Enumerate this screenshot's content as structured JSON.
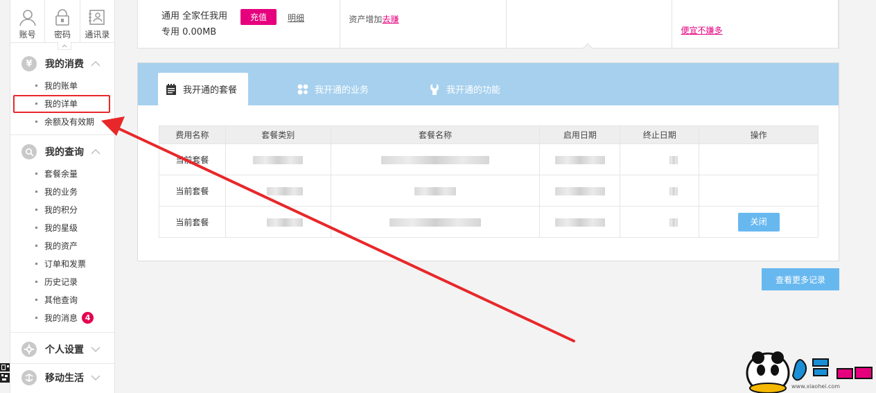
{
  "sidebar": {
    "top_icons": [
      {
        "label": "账号",
        "icon": "user-icon"
      },
      {
        "label": "密码",
        "icon": "lock-icon"
      },
      {
        "label": "通讯录",
        "icon": "contacts-icon"
      }
    ],
    "consumption": {
      "title": "我的消费",
      "icon_glyph": "¥",
      "items": [
        "我的账单",
        "我的详单",
        "余额及有效期"
      ]
    },
    "query": {
      "title": "我的查询",
      "items": [
        "套餐余量",
        "我的业务",
        "我的积分",
        "我的星级",
        "我的资产",
        "订单和发票",
        "历史记录",
        "其他查询",
        "我的消息"
      ],
      "message_badge": "4"
    },
    "settings": {
      "title": "个人设置"
    },
    "mobile_life": {
      "title": "移动生活"
    }
  },
  "summary": {
    "general_data": "通用 全家任我用",
    "special_data": "专用 0.00MB",
    "recharge_label": "充值",
    "detail_link": "明细",
    "asset_text": "资产增加",
    "asset_link": "去赚",
    "deal_link": "便宜不嫌多"
  },
  "panel": {
    "tabs": [
      "我开通的套餐",
      "我开通的业务",
      "我开通的功能"
    ],
    "table": {
      "headers": [
        "费用名称",
        "套餐类别",
        "套餐名称",
        "启用日期",
        "终止日期",
        "操作"
      ],
      "rows": [
        {
          "fee_name": "当前套餐",
          "action": ""
        },
        {
          "fee_name": "当前套餐",
          "action": ""
        },
        {
          "fee_name": "当前套餐",
          "action": "关闭"
        }
      ]
    },
    "more_label": "查看更多记录"
  },
  "watermark": {
    "url_text": "www.xiaohei.com"
  },
  "colors": {
    "accent_pink": "#e6007e",
    "tab_blue": "#a6d0ee",
    "button_blue": "#68b8f0",
    "annotation_red": "#e8272a"
  }
}
